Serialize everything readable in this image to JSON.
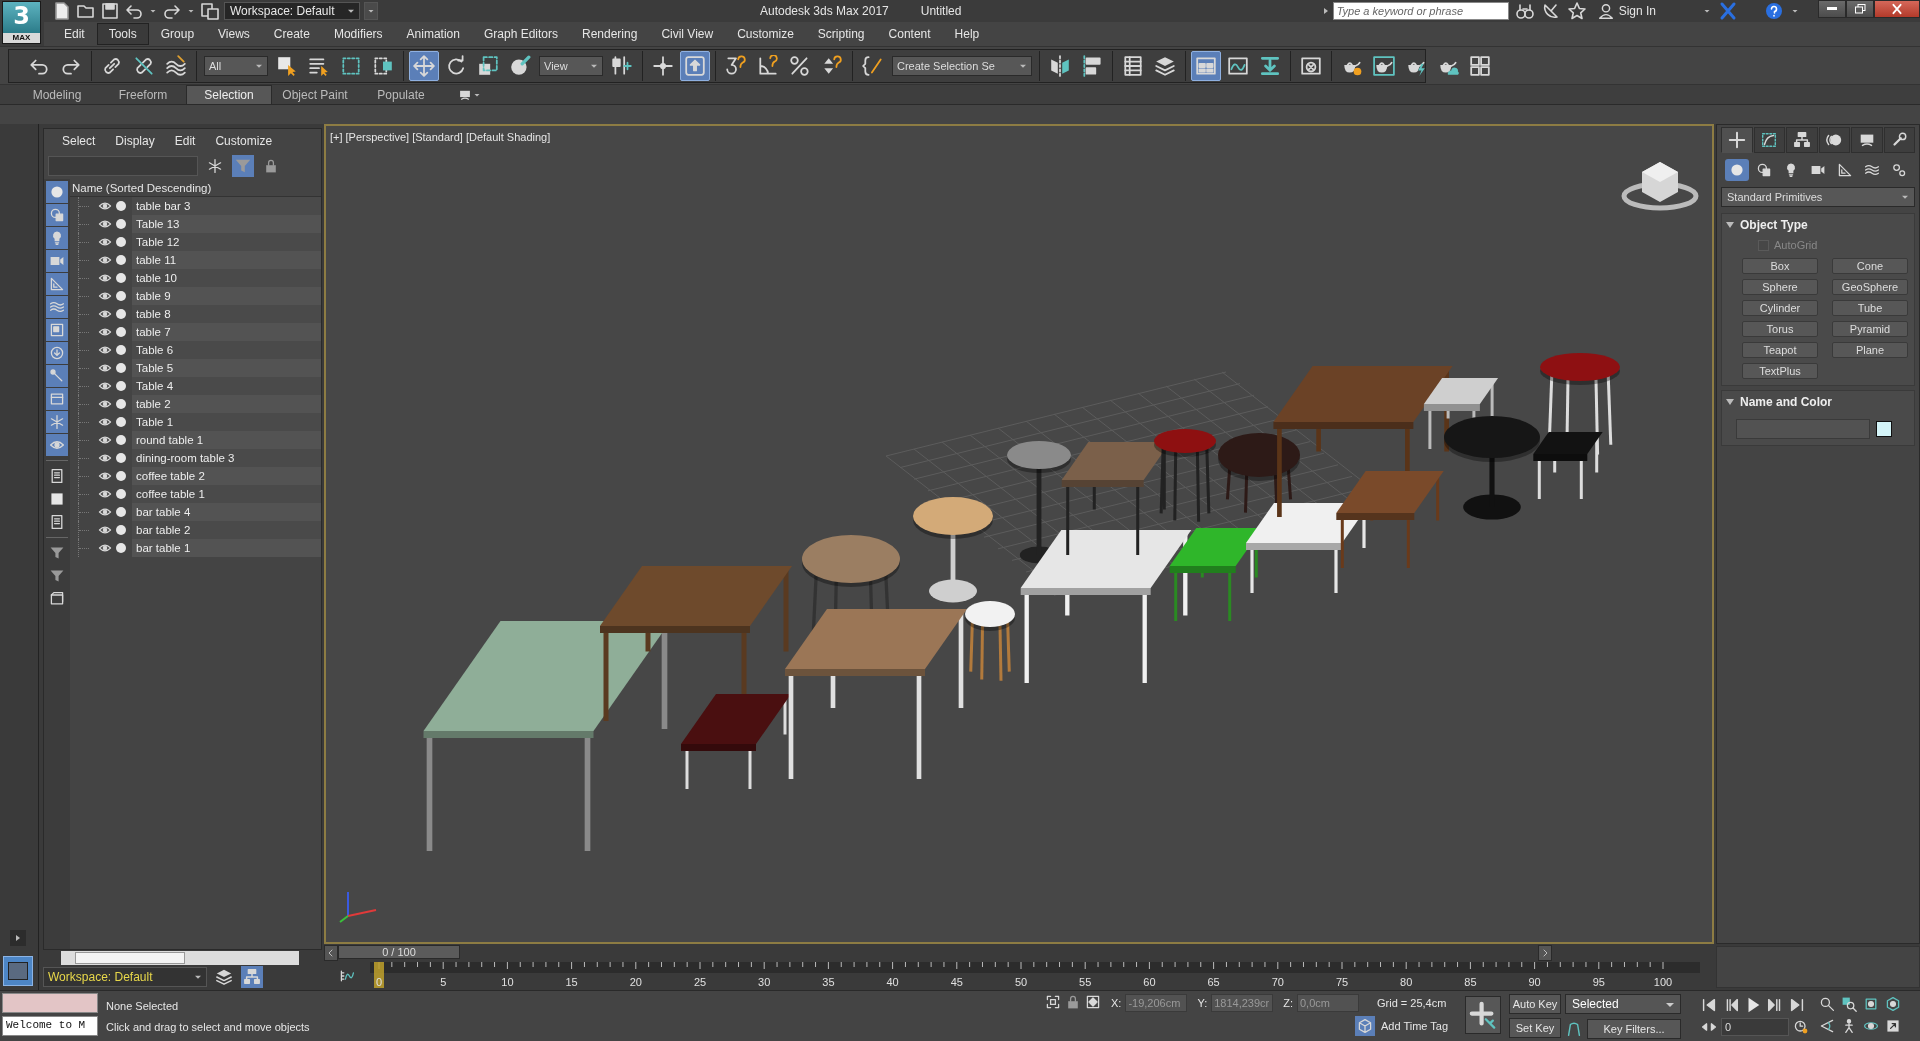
{
  "header": {
    "logo_number": "3",
    "logo_label": "MAX",
    "workspace": "Workspace: Default",
    "app_title": "Autodesk 3ds Max 2017",
    "document_title": "Untitled",
    "search": {
      "placeholder": "Type a keyword or phrase"
    },
    "sign_in": "Sign In"
  },
  "menu": [
    {
      "label": "Edit",
      "selected": false
    },
    {
      "label": "Tools",
      "selected": true
    },
    {
      "label": "Group",
      "selected": false
    },
    {
      "label": "Views",
      "selected": false
    },
    {
      "label": "Create",
      "selected": false
    },
    {
      "label": "Modifiers",
      "selected": false
    },
    {
      "label": "Animation",
      "selected": false
    },
    {
      "label": "Graph Editors",
      "selected": false
    },
    {
      "label": "Rendering",
      "selected": false
    },
    {
      "label": "Civil View",
      "selected": false
    },
    {
      "label": "Customize",
      "selected": false
    },
    {
      "label": "Scripting",
      "selected": false
    },
    {
      "label": "Content",
      "selected": false
    },
    {
      "label": "Help",
      "selected": false
    }
  ],
  "toolbar": [
    [
      {
        "kind": "button",
        "selected": false
      },
      {
        "kind": "button",
        "selected": false
      }
    ],
    [
      {
        "kind": "button",
        "selected": false
      },
      {
        "kind": "button",
        "selected": false
      },
      {
        "kind": "button",
        "selected": false
      }
    ],
    [
      {
        "kind": "dropdown",
        "value": "All"
      },
      {
        "kind": "button",
        "selected": false
      },
      {
        "kind": "button",
        "selected": false
      },
      {
        "kind": "button",
        "selected": false
      },
      {
        "kind": "button",
        "selected": false
      }
    ],
    [
      {
        "kind": "button",
        "selected": true
      },
      {
        "kind": "button",
        "selected": false
      },
      {
        "kind": "button",
        "selected": false
      },
      {
        "kind": "button",
        "selected": false
      },
      {
        "kind": "dropdown",
        "value": "View"
      },
      {
        "kind": "button",
        "selected": false
      }
    ],
    [
      {
        "kind": "button",
        "selected": false
      },
      {
        "kind": "button",
        "selected": true
      }
    ],
    [
      {
        "kind": "button",
        "selected": false
      },
      {
        "kind": "button",
        "selected": false
      },
      {
        "kind": "button",
        "selected": false
      },
      {
        "kind": "button",
        "selected": false
      }
    ],
    [
      {
        "kind": "button",
        "selected": false
      },
      {
        "kind": "dropdown",
        "value": "Create Selection Se"
      }
    ],
    [
      {
        "kind": "button",
        "selected": false
      },
      {
        "kind": "button",
        "selected": false
      }
    ],
    [
      {
        "kind": "button",
        "selected": false
      },
      {
        "kind": "button",
        "selected": false
      }
    ],
    [
      {
        "kind": "button",
        "selected": true
      },
      {
        "kind": "button",
        "selected": false
      },
      {
        "kind": "button",
        "selected": false
      }
    ],
    [
      {
        "kind": "button",
        "selected": false
      }
    ],
    [
      {
        "kind": "button",
        "selected": false
      },
      {
        "kind": "button",
        "selected": false
      },
      {
        "kind": "button",
        "selected": false
      },
      {
        "kind": "button",
        "selected": false
      },
      {
        "kind": "button",
        "selected": false
      }
    ]
  ],
  "ribbon": {
    "tabs": [
      {
        "label": "Modeling",
        "selected": false
      },
      {
        "label": "Freeform",
        "selected": false
      },
      {
        "label": "Selection",
        "selected": true
      },
      {
        "label": "Object Paint",
        "selected": false
      },
      {
        "label": "Populate",
        "selected": false
      }
    ]
  },
  "scene_explorer": {
    "menu": [
      "Select",
      "Display",
      "Edit",
      "Customize"
    ],
    "filter_toggle": {
      "selected": true
    },
    "filters": [
      {
        "selected": true
      },
      {
        "selected": true
      },
      {
        "selected": true
      },
      {
        "selected": true
      },
      {
        "selected": true
      },
      {
        "selected": true
      },
      {
        "selected": true
      },
      {
        "selected": true
      },
      {
        "selected": true
      },
      {
        "selected": true
      },
      {
        "selected": true
      },
      {
        "selected": true
      },
      {
        "selected": false
      },
      {
        "selected": false
      },
      {
        "selected": false
      }
    ],
    "column_header": "Name (Sorted Descending)",
    "rows": [
      {
        "name": "table bar 3"
      },
      {
        "name": "Table 13"
      },
      {
        "name": "Table 12"
      },
      {
        "name": "table 11"
      },
      {
        "name": "table 10"
      },
      {
        "name": "table 9"
      },
      {
        "name": "table 8"
      },
      {
        "name": "table 7"
      },
      {
        "name": "Table 6"
      },
      {
        "name": "Table 5"
      },
      {
        "name": "Table 4"
      },
      {
        "name": "table 2"
      },
      {
        "name": "Table 1"
      },
      {
        "name": "round table 1"
      },
      {
        "name": "dining-room table 3"
      },
      {
        "name": "coffee table 2"
      },
      {
        "name": "coffee table 1"
      },
      {
        "name": "bar table 4"
      },
      {
        "name": "bar table 2"
      },
      {
        "name": "bar table 1"
      }
    ],
    "workspace": "Workspace: Default"
  },
  "viewport": {
    "active": true,
    "labels": [
      "[+]",
      "[Perspective]",
      "[Standard]",
      "[Default Shading]"
    ]
  },
  "command_panel": {
    "tabs": [
      {
        "selected": true
      },
      {
        "selected": false
      },
      {
        "selected": false
      },
      {
        "selected": false
      },
      {
        "selected": false
      },
      {
        "selected": false
      }
    ],
    "categories": [
      {
        "selected": true
      },
      {
        "selected": false
      },
      {
        "selected": false
      },
      {
        "selected": false
      },
      {
        "selected": false
      },
      {
        "selected": false
      },
      {
        "selected": false
      }
    ],
    "object_class": "Standard Primitives",
    "rollouts": [
      {
        "kind": "object_type",
        "title": "Object Type",
        "expanded": true,
        "autogrid": {
          "label": "AutoGrid",
          "checked": false,
          "disabled": true
        },
        "buttons": [
          "Box",
          "Cone",
          "Sphere",
          "GeoSphere",
          "Cylinder",
          "Tube",
          "Torus",
          "Pyramid",
          "Teapot",
          "Plane",
          "TextPlus"
        ]
      },
      {
        "kind": "name_color",
        "title": "Name and Color",
        "expanded": true
      }
    ]
  },
  "time_slider": {
    "label": "0 / 100",
    "level": 0
  },
  "track_bar": {
    "ticks": [
      "0",
      "5",
      "10",
      "15",
      "20",
      "25",
      "30",
      "35",
      "40",
      "45",
      "50",
      "55",
      "60",
      "65",
      "70",
      "75",
      "80",
      "85",
      "90",
      "95",
      "100"
    ]
  },
  "status": {
    "listener_output": "Welcome to M",
    "selection": "None Selected",
    "prompt": "Click and drag to select and move objects",
    "coords": [
      {
        "label": "X:",
        "value": "-19,206cm"
      },
      {
        "label": "Y:",
        "value": "1814,239cr"
      },
      {
        "label": "Z:",
        "value": "0,0cm"
      }
    ],
    "grid": "Grid = 25,4cm",
    "time_tag": "Add Time Tag"
  },
  "animation": {
    "auto_key": "Auto Key",
    "set_key": "Set Key",
    "key_set": "Selected",
    "key_filters": "Key Filters...",
    "frame": "0"
  }
}
